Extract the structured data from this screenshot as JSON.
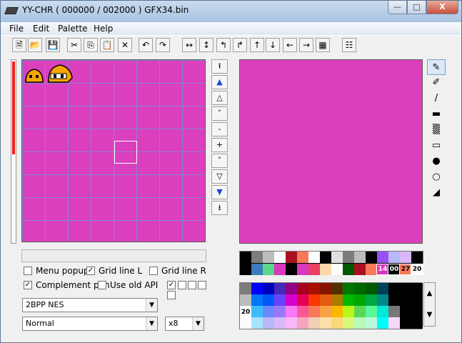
{
  "window": {
    "title": "YY-CHR ( 000000 / 002000 )  GFX34.bin",
    "minimize_label": "—",
    "maximize_label": "□",
    "close_label": "X"
  },
  "menu": [
    "File",
    "Edit",
    "Palette",
    "Help"
  ],
  "toolbar": {
    "icons": [
      "new-file-icon",
      "open-folder-icon",
      "save-icon",
      "cut-icon",
      "copy-icon",
      "paste-icon",
      "delete-icon",
      "undo-icon",
      "redo-icon",
      "flip-horizontal-icon",
      "flip-vertical-icon",
      "rotate-left-icon",
      "rotate-right-icon",
      "shift-up-icon",
      "shift-down-icon",
      "shift-left-icon",
      "shift-right-icon",
      "replace-color-icon",
      "property-icon"
    ],
    "glyphs": [
      "🗎",
      "📂",
      "💾",
      "✂",
      "⎘",
      "📋",
      "✕",
      "↶",
      "↷",
      "↔",
      "↕",
      "↰",
      "↱",
      "↑",
      "↓",
      "←",
      "→",
      "▦",
      "☷"
    ]
  },
  "scroll_buttons": [
    {
      "name": "scroll-top-button",
      "glyph": "⭱",
      "blue": false
    },
    {
      "name": "scroll-page-up-fast-button",
      "glyph": "▲",
      "blue": true
    },
    {
      "name": "scroll-page-up-button",
      "glyph": "△",
      "blue": false
    },
    {
      "name": "scroll-line-up-button",
      "glyph": "˄",
      "blue": false
    },
    {
      "name": "scroll-minus-button",
      "glyph": "-",
      "blue": false
    },
    {
      "name": "scroll-plus-button",
      "glyph": "+",
      "blue": false
    },
    {
      "name": "scroll-line-down-button",
      "glyph": "˅",
      "blue": false
    },
    {
      "name": "scroll-page-down-button",
      "glyph": "▽",
      "blue": false
    },
    {
      "name": "scroll-page-down-fast-button",
      "glyph": "▼",
      "blue": true
    },
    {
      "name": "scroll-bottom-button",
      "glyph": "⭳",
      "blue": false
    }
  ],
  "tools": [
    {
      "name": "pen-tool",
      "glyph": "✎"
    },
    {
      "name": "pattern-pen-tool",
      "glyph": "✐"
    },
    {
      "name": "line-tool",
      "glyph": "/"
    },
    {
      "name": "filled-rect-tool",
      "glyph": "▬"
    },
    {
      "name": "dither-rect-tool",
      "glyph": "▒"
    },
    {
      "name": "rect-outline-tool",
      "glyph": "▭"
    },
    {
      "name": "filled-circle-tool",
      "glyph": "●"
    },
    {
      "name": "circle-outline-tool",
      "glyph": "○"
    },
    {
      "name": "fill-bucket-tool",
      "glyph": "◢"
    }
  ],
  "options": {
    "menu_popup": {
      "label": "Menu popup",
      "checked": false
    },
    "grid_line_l": {
      "label": "Grid line L",
      "checked": true
    },
    "grid_line_r": {
      "label": "Grid line R",
      "checked": false
    },
    "complement_pen": {
      "label": "Complement pen",
      "checked": true
    },
    "use_old_api": {
      "label": "Use old API",
      "checked": false
    }
  },
  "format_select": {
    "value": "2BPP NES"
  },
  "mode_select": {
    "value": "Normal"
  },
  "zoom_select": {
    "value": "x8"
  },
  "palette": {
    "top_row": [
      "#000000",
      "#7c7c7c",
      "#bcbcbc",
      "#fcfcfc",
      "#a81020",
      "#f87858",
      "#fcfcfc",
      "#000000",
      "#e0e0e0",
      "#7c7c7c",
      "#bcbcbc",
      "#000000",
      "#9850f8",
      "#b8b8f8",
      "#d8b8f8",
      "#000000"
    ],
    "bottom_row": [
      "#000000",
      "#3c7cbc",
      "#58d888",
      "#d838bc",
      "#000000",
      "#d838bc",
      "#e84060",
      "#fcd8a8",
      "#fcfcfc",
      "#005800",
      "#a81020",
      "#f87858",
      "#d838bc",
      "#000000",
      "#f87858",
      "#fcfcfc"
    ],
    "labels": [
      "14",
      "00",
      "27",
      "20"
    ],
    "master_label": "20",
    "master": [
      [
        "#7c7c7c",
        "#0000fc",
        "#0000bc",
        "#4428bc",
        "#940084",
        "#a80020",
        "#a81000",
        "#881400",
        "#503000",
        "#007800",
        "#006800",
        "#005800",
        "#004058",
        "#000000",
        "#000000",
        "#000000"
      ],
      [
        "#bcbcbc",
        "#0078f8",
        "#0058f8",
        "#6844fc",
        "#d800cc",
        "#e40058",
        "#f83800",
        "#e45c10",
        "#ac7c00",
        "#00b800",
        "#00a800",
        "#00a844",
        "#008888",
        "#000000",
        "#000000",
        "#000000"
      ],
      [
        "#f8f8f8",
        "#3cbcfc",
        "#6888fc",
        "#9878f8",
        "#f878f8",
        "#f85898",
        "#f87858",
        "#fca044",
        "#f8b800",
        "#b8f818",
        "#58d854",
        "#58f898",
        "#00e8d8",
        "#787878",
        "#000000",
        "#000000"
      ],
      [
        "#fcfcfc",
        "#a4e4fc",
        "#b8b8f8",
        "#d8b8f8",
        "#f8b8f8",
        "#f8a4c0",
        "#f0d0b0",
        "#fce0a8",
        "#f8d878",
        "#d8f878",
        "#b8f8b8",
        "#b8f8d8",
        "#00fcfc",
        "#f8d8f8",
        "#000000",
        "#000000"
      ]
    ]
  }
}
